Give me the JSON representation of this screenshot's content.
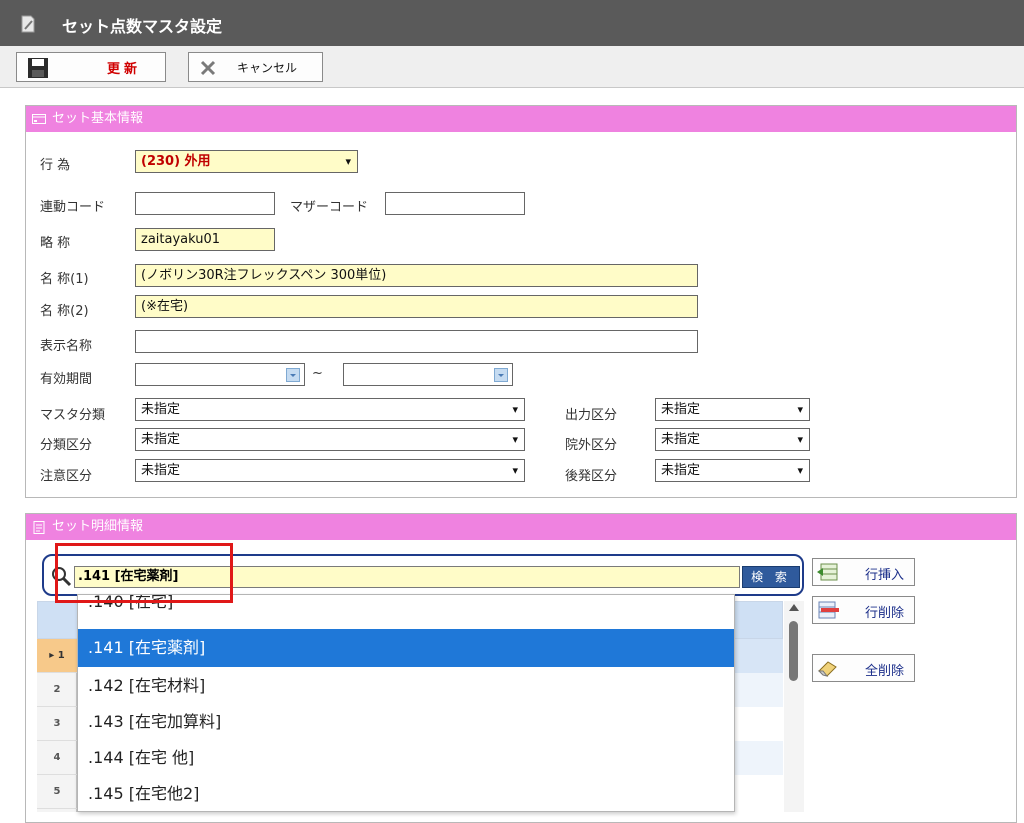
{
  "window": {
    "title": "セット点数マスタ設定"
  },
  "toolbar": {
    "update_label": "更新",
    "cancel_label": "キャンセル"
  },
  "basic_panel": {
    "title": "セット基本情報",
    "koui_label": "行 為",
    "koui_value": "(230) 外用",
    "rendou_label": "連動コード",
    "rendou_value": "",
    "mother_label": "マザーコード",
    "mother_value": "",
    "ryakusho_label": "略 称",
    "ryakusho_value": "zaitayaku01",
    "name1_label": "名 称(1)",
    "name1_value": "(ノボリン30R注フレックスペン 300単位)",
    "name2_label": "名 称(2)",
    "name2_value": "(※在宅)",
    "display_name_label": "表示名称",
    "display_name_value": "",
    "period_label": "有効期間",
    "period_sep": "~",
    "master_class_label": "マスタ分類",
    "master_class_value": "未指定",
    "class_label": "分類区分",
    "class_value": "未指定",
    "caution_label": "注意区分",
    "caution_value": "未指定",
    "output_label": "出力区分",
    "output_value": "未指定",
    "inout_label": "院外区分",
    "inout_value": "未指定",
    "generic_label": "後発区分",
    "generic_value": "未指定"
  },
  "detail_panel": {
    "title": "セット明細情報",
    "search_value": ".141 [在宅薬剤]",
    "search_button": "検 索",
    "insert_button": "行挿入",
    "delete_button": "行削除",
    "delete_all_button": "全削除",
    "row_numbers": [
      "1",
      "2",
      "3",
      "4",
      "5"
    ],
    "dropdown_items": [
      ".140 [在宅]",
      ".141 [在宅薬剤]",
      ".142 [在宅材料]",
      ".143 [在宅加算料]",
      ".144 [在宅 他]",
      ".145 [在宅他2]"
    ],
    "selected_index": 1
  },
  "colors": {
    "title_bar": "#5a5a5a",
    "panel_header": "#ef82e0",
    "highlight_field": "#fffcc8",
    "selected_item": "#1f78d8",
    "update_text": "#d00000",
    "annotation_box": "#e01818"
  }
}
